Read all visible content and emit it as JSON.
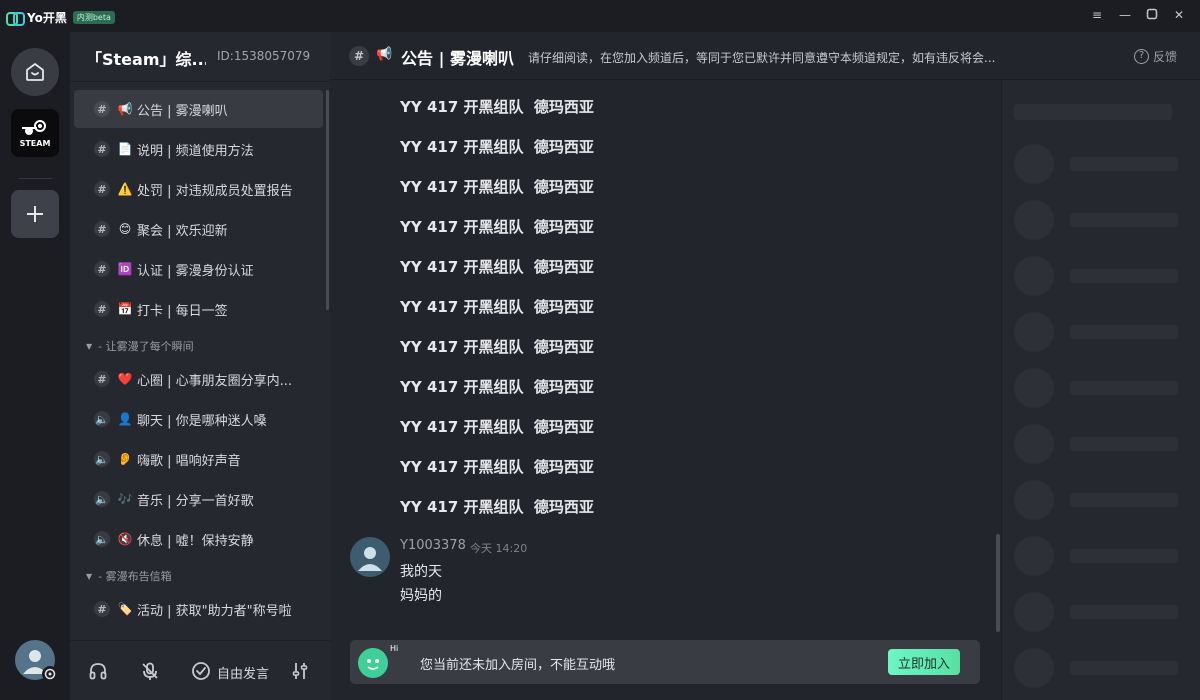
{
  "app": {
    "name": "Yo开黑",
    "beta_badge": "内测beta"
  },
  "server": {
    "name": "「Steam」综...",
    "id_label": "ID:1538057079",
    "rail_steam_label": "STEAM"
  },
  "channels_top": [
    {
      "prefix": "#",
      "emoji": "📢",
      "label": "公告 | 雾漫喇叭",
      "active": true
    },
    {
      "prefix": "#",
      "emoji": "📄",
      "label": "说明 | 频道使用方法"
    },
    {
      "prefix": "#",
      "emoji": "⚠️",
      "label": "处罚 | 对违规成员处置报告"
    },
    {
      "prefix": "#",
      "emoji": "😊",
      "label": "聚会 | 欢乐迎新"
    },
    {
      "prefix": "#",
      "emoji": "🆔",
      "label": "认证 | 雾漫身份认证"
    },
    {
      "prefix": "#",
      "emoji": "📅",
      "label": "打卡 | 每日一签"
    }
  ],
  "category1": "- 让雾漫了每个瞬间",
  "channels_mid": [
    {
      "prefix": "#",
      "emoji": "❤️",
      "label": "心圈 | 心事朋友圈分享内..."
    },
    {
      "prefix": "🔈",
      "emoji": "👤",
      "label": "聊天 | 你是哪种迷人嗓"
    },
    {
      "prefix": "🔈",
      "emoji": "👂",
      "label": "嗨歌 | 唱响好声音"
    },
    {
      "prefix": "🔈",
      "emoji": "🎶",
      "label": "音乐 | 分享一首好歌"
    },
    {
      "prefix": "🔈",
      "emoji": "🔇",
      "label": "休息 | 嘘！保持安静"
    }
  ],
  "category2": "- 雾漫布告信箱",
  "channels_bottom": [
    {
      "prefix": "#",
      "emoji": "🏷️",
      "label": "活动 | 获取\"助力者\"称号啦"
    }
  ],
  "footer": {
    "free_speak": "自由发言"
  },
  "main_header": {
    "emoji": "📢",
    "title": "公告 | 雾漫喇叭",
    "topic": "请仔细阅读，在您加入频道后，等同于您已默许并同意遵守本频道规定，如有违反将会...",
    "feedback": "反馈"
  },
  "messages": {
    "repeated_lines": [
      "YY 417 开黑组队  德玛西亚",
      "YY 417 开黑组队  德玛西亚",
      "YY 417 开黑组队  德玛西亚",
      "YY 417 开黑组队  德玛西亚",
      "YY 417 开黑组队  德玛西亚",
      "YY 417 开黑组队  德玛西亚",
      "YY 417 开黑组队  德玛西亚",
      "YY 417 开黑组队  德玛西亚",
      "YY 417 开黑组队  德玛西亚",
      "YY 417 开黑组队  德玛西亚",
      "YY 417 开黑组队  德玛西亚"
    ],
    "last": {
      "author": "Y1003378",
      "time": "今天 14:20",
      "lines": [
        "我的天",
        "妈妈的"
      ]
    }
  },
  "join_bar": {
    "hi": "Hi",
    "text": "您当前还未加入房间，不能互动哦",
    "button": "立即加入"
  },
  "colors": {
    "accent": "#58e0a3",
    "background": "#23252c",
    "sidebar": "#26282f",
    "rail": "#1c1d22"
  }
}
